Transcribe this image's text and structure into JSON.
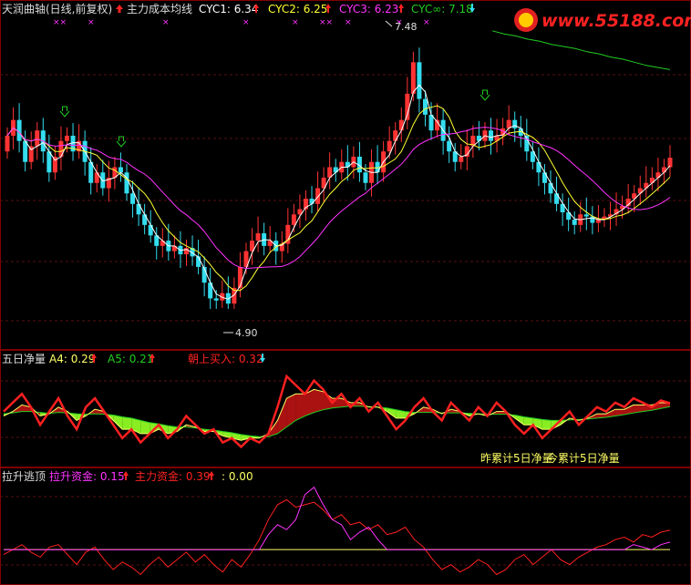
{
  "colors": {
    "background": "#000000",
    "frame": "#800000",
    "grid": "#7a1f1f",
    "up": "#ff3333",
    "down": "#33ddee",
    "cyc1": "#ffffff",
    "cyc2": "#ffff33",
    "cyc3": "#ff33ff",
    "cyc_inf": "#22cc22",
    "net_red": "#ff2020",
    "net_yellow": "#ffff66",
    "net_green": "#22cc22",
    "fill_green": "#88ee22",
    "fill_red": "#aa1111"
  },
  "icons": [
    "up-arrow-icon",
    "down-arrow-icon",
    "buy-arrow-icon",
    "sell-arrow-icon",
    "cross-marker-icon"
  ],
  "watermark": {
    "text": "www.55188.com"
  },
  "panel1": {
    "title": "天润曲轴(日线,前复权)",
    "legend_intro": "主力成本均线",
    "cyc1": "CYC1: 6.34",
    "cyc2": "CYC2: 6.25",
    "cyc3": "CYC3: 6.23",
    "cyc_inf": "CYC∞: 7.18",
    "high_label": "7.48",
    "low_label": "4.90"
  },
  "panel2": {
    "title": "五日净量",
    "a4": "A4: 0.29",
    "a5": "A5: 0.21",
    "buy": "朝上买入: 0.32",
    "note1": "昨累计5日净量",
    "note2": "今累计5日净量"
  },
  "panel3": {
    "title": "拉升逃顶",
    "lift": "拉升资金: 0.15",
    "main": "主力资金: 0.39",
    "zero": ": 0.00"
  },
  "chart_data": [
    {
      "type": "candlestick",
      "title": "天润曲轴(日线,前复权)",
      "ylim": [
        4.7,
        7.6
      ],
      "high": 7.48,
      "low": 4.9,
      "series": [
        {
          "name": "CYC1",
          "last": 6.34
        },
        {
          "name": "CYC2",
          "last": 6.25
        },
        {
          "name": "CYC3",
          "last": 6.23
        },
        {
          "name": "CYC∞",
          "last": 7.18
        }
      ],
      "close": [
        6.55,
        6.7,
        6.5,
        6.3,
        6.45,
        6.6,
        6.4,
        6.2,
        6.35,
        6.5,
        6.55,
        6.4,
        6.5,
        6.3,
        6.1,
        6.2,
        6.05,
        6.15,
        6.25,
        6.2,
        6.0,
        5.9,
        5.8,
        5.7,
        5.6,
        5.5,
        5.55,
        5.45,
        5.5,
        5.42,
        5.48,
        5.4,
        5.3,
        5.15,
        5.0,
        4.98,
        5.05,
        4.95,
        5.1,
        5.3,
        5.45,
        5.55,
        5.62,
        5.5,
        5.55,
        5.45,
        5.52,
        5.7,
        5.8,
        5.85,
        5.95,
        5.9,
        6.05,
        6.15,
        6.25,
        6.2,
        6.3,
        6.25,
        6.35,
        6.2,
        6.1,
        6.3,
        6.2,
        6.4,
        6.5,
        6.6,
        6.7,
        6.95,
        7.25,
        6.9,
        6.75,
        6.6,
        6.7,
        6.5,
        6.4,
        6.3,
        6.35,
        6.45,
        6.55,
        6.5,
        6.6,
        6.5,
        6.55,
        6.62,
        6.7,
        6.62,
        6.55,
        6.4,
        6.3,
        6.2,
        6.1,
        6.0,
        5.9,
        5.82,
        5.75,
        5.7,
        5.8,
        5.78,
        5.72,
        5.75,
        5.78,
        5.8,
        5.85,
        5.88,
        5.95,
        6.0,
        6.05,
        6.1,
        6.15,
        6.2,
        6.25,
        6.34
      ],
      "open": [
        6.4,
        6.55,
        6.7,
        6.5,
        6.3,
        6.45,
        6.6,
        6.4,
        6.2,
        6.35,
        6.5,
        6.55,
        6.4,
        6.5,
        6.3,
        6.1,
        6.2,
        6.05,
        6.15,
        6.25,
        6.2,
        6.0,
        5.9,
        5.8,
        5.7,
        5.6,
        5.5,
        5.55,
        5.45,
        5.5,
        5.42,
        5.48,
        5.4,
        5.3,
        5.15,
        5.0,
        4.98,
        5.05,
        4.95,
        5.1,
        5.3,
        5.45,
        5.55,
        5.62,
        5.5,
        5.55,
        5.45,
        5.52,
        5.7,
        5.8,
        5.85,
        5.95,
        5.9,
        6.05,
        6.15,
        6.25,
        6.2,
        6.3,
        6.25,
        6.35,
        6.2,
        6.1,
        6.3,
        6.2,
        6.4,
        6.5,
        6.6,
        6.7,
        6.95,
        7.25,
        6.9,
        6.75,
        6.6,
        6.7,
        6.5,
        6.4,
        6.3,
        6.35,
        6.45,
        6.55,
        6.5,
        6.6,
        6.5,
        6.55,
        6.62,
        6.7,
        6.62,
        6.55,
        6.4,
        6.3,
        6.2,
        6.1,
        6.0,
        5.9,
        5.82,
        5.75,
        5.7,
        5.8,
        5.78,
        5.72,
        5.75,
        5.78,
        5.8,
        5.85,
        5.88,
        5.95,
        6.0,
        6.05,
        6.1,
        6.15,
        6.2,
        6.25
      ],
      "cyc_inf_line": [
        7.55,
        7.52,
        7.5,
        7.47,
        7.45,
        7.42,
        7.4,
        7.38,
        7.35,
        7.33,
        7.3,
        7.28,
        7.25,
        7.22,
        7.2,
        7.18
      ]
    },
    {
      "type": "line",
      "title": "五日净量",
      "series": [
        {
          "name": "A4",
          "last": 0.29
        },
        {
          "name": "A5",
          "last": 0.21
        },
        {
          "name": "朝上买入",
          "last": 0.32
        }
      ],
      "ylim": [
        -1,
        1
      ],
      "net": [
        0.1,
        0.3,
        0.5,
        0.2,
        -0.2,
        0.1,
        0.4,
        0.0,
        -0.3,
        0.2,
        0.4,
        0.1,
        -0.2,
        -0.5,
        -0.3,
        -0.6,
        -0.4,
        -0.2,
        -0.5,
        -0.3,
        0.0,
        -0.2,
        -0.4,
        -0.3,
        -0.6,
        -0.5,
        -0.7,
        -0.5,
        -0.6,
        -0.4,
        0.2,
        0.9,
        0.7,
        0.5,
        0.8,
        0.6,
        0.3,
        0.5,
        0.2,
        0.4,
        0.1,
        0.3,
        0.0,
        -0.3,
        -0.1,
        0.2,
        0.4,
        0.1,
        -0.1,
        0.3,
        0.1,
        -0.1,
        0.2,
        0.0,
        0.3,
        0.1,
        -0.2,
        -0.4,
        -0.2,
        -0.5,
        -0.3,
        -0.1,
        0.1,
        -0.2,
        0.0,
        0.2,
        0.1,
        0.3,
        0.2,
        0.4,
        0.3,
        0.2,
        0.35,
        0.29
      ],
      "a4": [
        0.0,
        0.1,
        0.25,
        0.2,
        0.0,
        0.05,
        0.2,
        0.1,
        -0.1,
        0.0,
        0.15,
        0.1,
        -0.1,
        -0.3,
        -0.3,
        -0.4,
        -0.4,
        -0.3,
        -0.4,
        -0.35,
        -0.2,
        -0.25,
        -0.35,
        -0.35,
        -0.45,
        -0.5,
        -0.55,
        -0.5,
        -0.5,
        -0.4,
        -0.1,
        0.4,
        0.5,
        0.5,
        0.6,
        0.55,
        0.4,
        0.4,
        0.3,
        0.3,
        0.2,
        0.2,
        0.1,
        -0.05,
        -0.05,
        0.05,
        0.2,
        0.15,
        0.05,
        0.15,
        0.1,
        0.0,
        0.05,
        0.0,
        0.1,
        0.1,
        -0.05,
        -0.2,
        -0.2,
        -0.3,
        -0.3,
        -0.2,
        -0.05,
        -0.1,
        -0.05,
        0.05,
        0.05,
        0.15,
        0.15,
        0.25,
        0.25,
        0.25,
        0.3,
        0.29
      ],
      "a5": [
        0.05,
        0.07,
        0.1,
        0.1,
        0.08,
        0.06,
        0.08,
        0.07,
        0.05,
        0.04,
        0.05,
        0.04,
        0.02,
        -0.02,
        -0.05,
        -0.1,
        -0.15,
        -0.18,
        -0.22,
        -0.25,
        -0.25,
        -0.27,
        -0.3,
        -0.32,
        -0.35,
        -0.38,
        -0.42,
        -0.45,
        -0.47,
        -0.47,
        -0.4,
        -0.25,
        -0.1,
        0.0,
        0.08,
        0.14,
        0.18,
        0.2,
        0.22,
        0.22,
        0.21,
        0.2,
        0.18,
        0.14,
        0.1,
        0.08,
        0.08,
        0.08,
        0.07,
        0.07,
        0.07,
        0.06,
        0.05,
        0.04,
        0.04,
        0.04,
        0.02,
        -0.02,
        -0.05,
        -0.08,
        -0.1,
        -0.1,
        -0.09,
        -0.08,
        -0.07,
        -0.05,
        -0.03,
        0.0,
        0.03,
        0.07,
        0.1,
        0.13,
        0.17,
        0.21
      ]
    },
    {
      "type": "line",
      "title": "拉升逃顶",
      "series": [
        {
          "name": "拉升资金",
          "last": 0.15
        },
        {
          "name": "主力资金",
          "last": 0.39
        },
        {
          "name": "",
          "last": 0.0
        }
      ],
      "ylim": [
        -0.6,
        1.3
      ],
      "main_fund": [
        -0.1,
        0.0,
        0.1,
        -0.05,
        -0.15,
        0.05,
        0.1,
        -0.1,
        -0.3,
        -0.05,
        0.05,
        -0.2,
        -0.4,
        -0.25,
        -0.35,
        -0.5,
        -0.3,
        -0.15,
        -0.35,
        -0.2,
        -0.05,
        -0.25,
        -0.1,
        -0.3,
        -0.45,
        -0.2,
        -0.35,
        -0.1,
        0.2,
        0.6,
        0.9,
        1.0,
        0.85,
        0.9,
        0.95,
        0.8,
        0.6,
        0.7,
        0.5,
        0.55,
        0.4,
        0.5,
        0.3,
        0.35,
        0.45,
        0.2,
        0.05,
        -0.2,
        -0.4,
        -0.3,
        -0.45,
        -0.35,
        -0.2,
        -0.3,
        -0.5,
        -0.4,
        -0.2,
        -0.1,
        -0.3,
        -0.15,
        0.0,
        -0.2,
        -0.3,
        -0.15,
        -0.05,
        0.05,
        0.1,
        0.2,
        0.25,
        0.15,
        0.3,
        0.25,
        0.35,
        0.39
      ],
      "lift_fund": [
        0,
        0,
        0,
        0,
        0,
        0,
        0,
        0,
        0,
        0,
        0,
        0,
        0,
        0,
        0,
        0,
        0,
        0,
        0,
        0,
        0,
        0,
        0,
        0,
        0,
        0,
        0,
        0,
        0,
        0.3,
        0.5,
        0.4,
        0.6,
        1.1,
        1.25,
        0.9,
        0.6,
        0.5,
        0.2,
        0.35,
        0.45,
        0.2,
        0,
        0,
        0,
        0,
        0,
        0,
        0,
        0,
        0,
        0,
        0,
        0,
        0,
        0,
        0,
        0,
        0,
        0,
        0,
        0,
        0,
        0,
        0,
        0,
        0,
        0,
        0,
        0.1,
        0.05,
        0.0,
        0.1,
        0.15
      ]
    }
  ]
}
